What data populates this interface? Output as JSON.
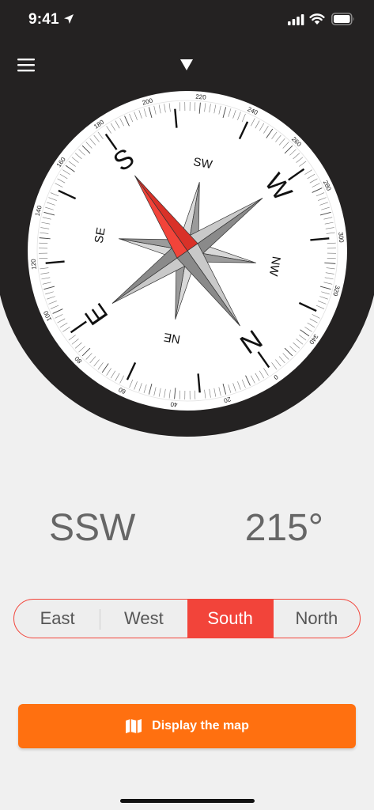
{
  "status_bar": {
    "time": "9:41",
    "icons": [
      "location-arrow-icon",
      "cellular-signal-icon",
      "wifi-icon",
      "battery-icon"
    ]
  },
  "header": {
    "menu_icon": "hamburger-menu-icon",
    "heading_marker_icon": "triangle-down-icon"
  },
  "compass": {
    "heading_degrees": 215,
    "cardinal_labels": [
      "S",
      "W",
      "N",
      "E"
    ],
    "intercardinal_labels": [
      "SW",
      "NW",
      "NE",
      "SE"
    ],
    "degree_labels": [
      "0",
      "20",
      "40",
      "60",
      "80",
      "100",
      "120",
      "140",
      "160",
      "180",
      "200",
      "220",
      "240",
      "260",
      "280",
      "300",
      "320",
      "340"
    ],
    "needle_color": "#f2443a"
  },
  "readout": {
    "direction": "SSW",
    "degrees": "215°"
  },
  "segments": {
    "items": [
      "East",
      "West",
      "South",
      "North"
    ],
    "selected": "South"
  },
  "map_button": {
    "label": "Display the map",
    "icon": "map-icon"
  },
  "colors": {
    "accent": "#f2443a",
    "button": "#ff7010",
    "header_bg": "#242222",
    "page_bg": "#f0f0f0"
  }
}
